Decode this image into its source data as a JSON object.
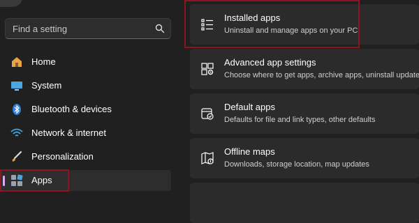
{
  "search": {
    "placeholder": "Find a setting"
  },
  "sidebar": {
    "items": [
      {
        "label": "Home",
        "icon": "home-icon"
      },
      {
        "label": "System",
        "icon": "system-icon"
      },
      {
        "label": "Bluetooth & devices",
        "icon": "bluetooth-icon"
      },
      {
        "label": "Network & internet",
        "icon": "wifi-icon"
      },
      {
        "label": "Personalization",
        "icon": "brush-icon"
      },
      {
        "label": "Apps",
        "icon": "apps-icon",
        "active": true
      }
    ]
  },
  "main": {
    "cards": [
      {
        "title": "Installed apps",
        "subtitle": "Uninstall and manage apps on your PC",
        "icon": "list-icon"
      },
      {
        "title": "Advanced app settings",
        "subtitle": "Choose where to get apps, archive apps, uninstall updates",
        "icon": "app-settings-icon"
      },
      {
        "title": "Default apps",
        "subtitle": "Defaults for file and link types, other defaults",
        "icon": "default-apps-icon"
      },
      {
        "title": "Offline maps",
        "subtitle": "Downloads, storage location, map updates",
        "icon": "map-icon"
      }
    ]
  },
  "colors": {
    "background": "#202020",
    "card": "#2b2b2b",
    "highlight": "#8e1420",
    "accent": "#d8b0f0"
  }
}
